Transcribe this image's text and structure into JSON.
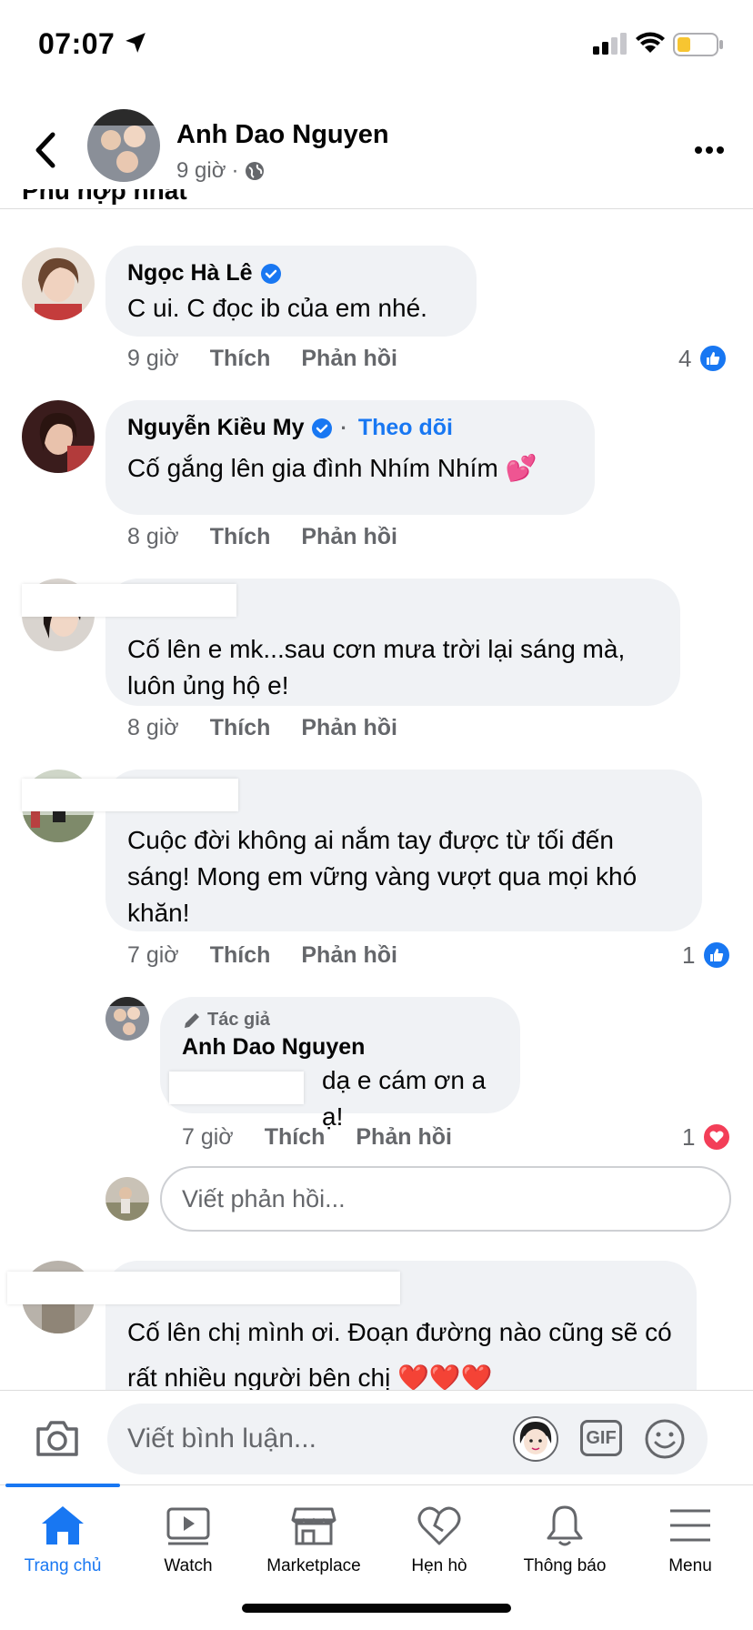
{
  "status_bar": {
    "time": "07:07"
  },
  "post_header": {
    "author": "Anh Dao Nguyen",
    "time": "9 giờ",
    "separator": "·"
  },
  "section_title": "Phù hợp nhất",
  "comments": [
    {
      "name": "Ngọc Hà Lê",
      "verified": true,
      "text": "C ui. C đọc ib của em nhé.",
      "time": "9 giờ",
      "like_label": "Thích",
      "reply_label": "Phản hồi",
      "reactions": "4",
      "reaction_type": "like"
    },
    {
      "name": "Nguyễn Kiều My",
      "verified": true,
      "follow_label": "Theo dõi",
      "text": "Cố gắng lên gia đình Nhím Nhím 💕",
      "time": "8 giờ",
      "like_label": "Thích",
      "reply_label": "Phản hồi"
    },
    {
      "text": "Cố lên e mk...sau cơn mưa trời lại sáng mà, luôn ủng hộ e!",
      "time": "8 giờ",
      "like_label": "Thích",
      "reply_label": "Phản hồi"
    },
    {
      "text": "Cuộc đời không ai nắm tay được từ tối đến sáng! Mong em vững vàng vượt qua mọi khó khăn!",
      "time": "7 giờ",
      "like_label": "Thích",
      "reply_label": "Phản hồi",
      "reactions": "1",
      "reaction_type": "like"
    },
    {
      "text": "Cố lên chị mình ơi. Đoạn đường nào cũng sẽ có rất nhiều người bên chị ❤️❤️❤️"
    }
  ],
  "reply": {
    "author_tag": "Tác giả",
    "name": "Anh Dao Nguyen",
    "text": "dạ e cám ơn a ạ!",
    "time": "7 giờ",
    "like_label": "Thích",
    "reply_label": "Phản hồi",
    "reactions": "1",
    "reaction_type": "love"
  },
  "reply_input_placeholder": "Viết phản hồi...",
  "composer": {
    "placeholder": "Viết bình luận...",
    "gif_label": "GIF"
  },
  "bottom_nav": [
    {
      "label": "Trang chủ",
      "icon": "home-icon",
      "active": true
    },
    {
      "label": "Watch",
      "icon": "watch-icon"
    },
    {
      "label": "Marketplace",
      "icon": "marketplace-icon"
    },
    {
      "label": "Hẹn hò",
      "icon": "dating-heart-icon"
    },
    {
      "label": "Thông báo",
      "icon": "bell-icon"
    },
    {
      "label": "Menu",
      "icon": "menu-icon"
    }
  ],
  "colors": {
    "accent": "#1877f2",
    "bubble": "#f0f2f5",
    "secondary_text": "#65676b",
    "love": "#f33e58"
  }
}
